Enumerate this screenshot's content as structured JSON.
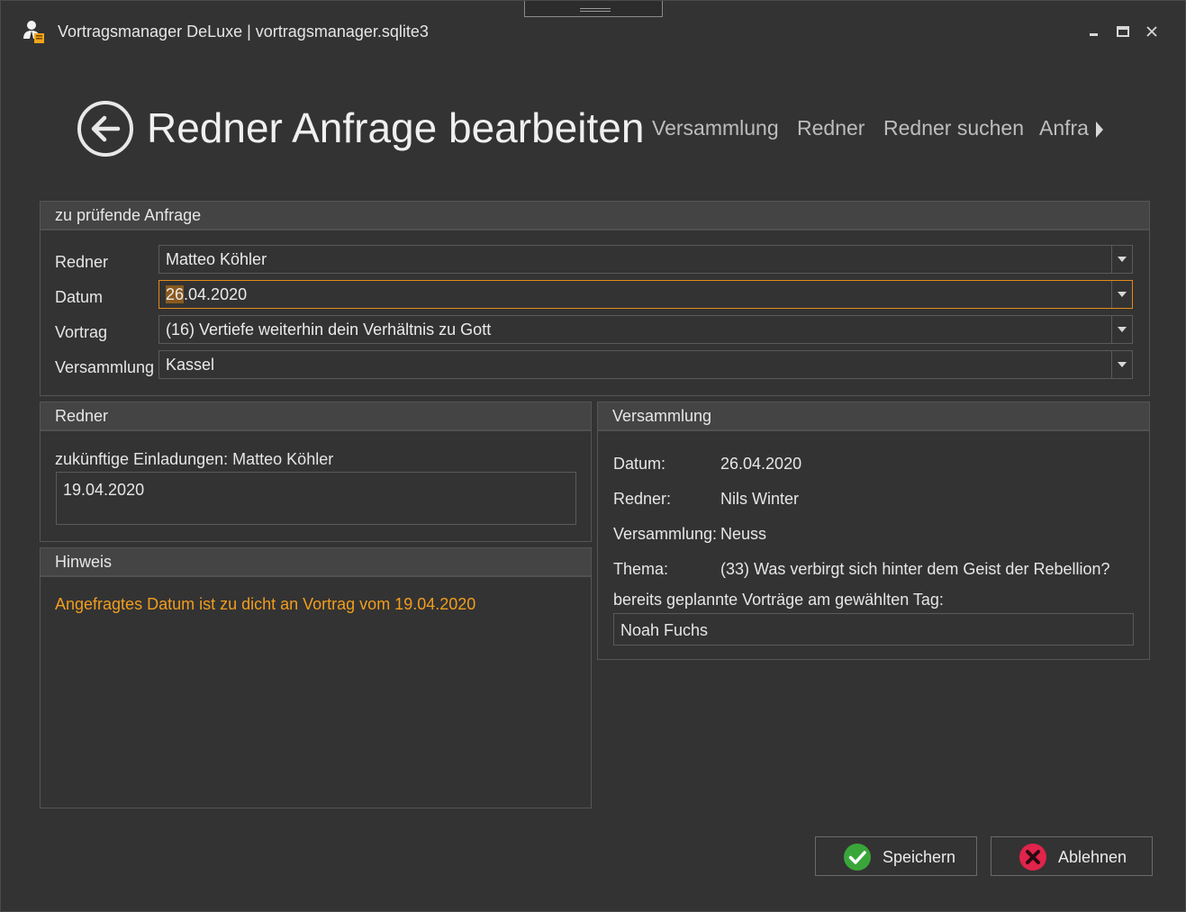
{
  "window": {
    "title": "Vortragsmanager DeLuxe | vortragsmanager.sqlite3"
  },
  "header": {
    "page_title": "Redner Anfrage bearbeiten",
    "nav": [
      "Versammlung",
      "Redner",
      "Redner suchen",
      "Anfragen"
    ]
  },
  "request": {
    "header": "zu prüfende Anfrage",
    "fields": [
      {
        "label": "Redner",
        "value": "Matteo Köhler"
      },
      {
        "label": "Datum",
        "value_selected": "26",
        "value_rest": ".04.2020"
      },
      {
        "label": "Vortrag",
        "value": "(16) Vertiefe weiterhin dein Verhältnis zu Gott"
      },
      {
        "label": "Versammlung",
        "value": "Kassel"
      }
    ]
  },
  "speaker": {
    "header": "Redner",
    "future_label": "zukünftige Einladungen: Matteo Köhler",
    "future_items": [
      "19.04.2020"
    ]
  },
  "hint": {
    "header": "Hinweis",
    "message": "Angefragtes Datum ist zu dicht an Vortrag vom 19.04.2020",
    "message_color": "#f29d1d"
  },
  "congregation": {
    "header": "Versammlung",
    "rows": [
      {
        "label": "Datum:",
        "value": "26.04.2020"
      },
      {
        "label": "Redner:",
        "value": "Nils Winter"
      },
      {
        "label": "Versammlung:",
        "value": "Neuss"
      },
      {
        "label": "Thema:",
        "value": "(33) Was verbirgt sich hinter dem Geist der Rebellion?"
      }
    ],
    "planned_label": "bereits geplannte Vorträge am gewählten Tag:",
    "planned_items": [
      "Noah Fuchs"
    ]
  },
  "actions": {
    "save_label": "Speichern",
    "reject_label": "Ablehnen",
    "save_color": "#3aa63a",
    "reject_color": "#e0244a"
  }
}
